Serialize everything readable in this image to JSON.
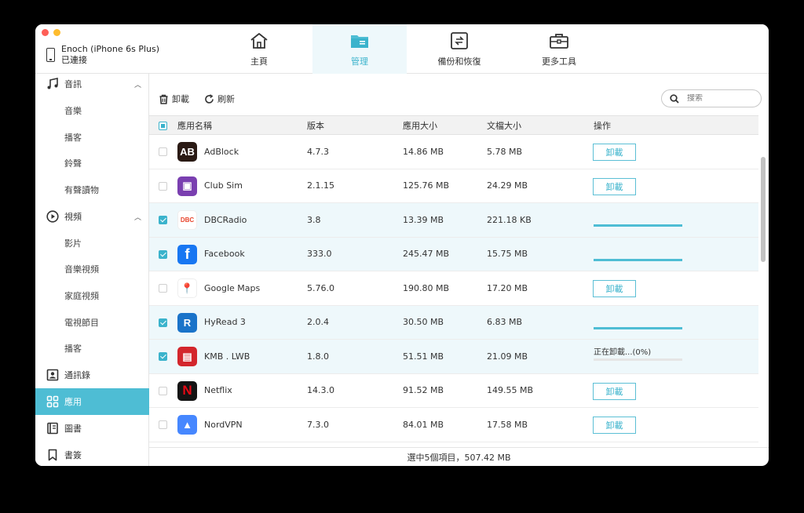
{
  "colors": {
    "accent": "#3bb3cc",
    "accent_light": "#eef8fb",
    "sidebar_active": "#4ebdd4",
    "close": "#fe5f57",
    "minimize": "#febc2e"
  },
  "device": {
    "name": "Enoch (iPhone 6s Plus)",
    "status": "已連接"
  },
  "nav": [
    {
      "label": "主頁",
      "icon": "home-icon"
    },
    {
      "label": "管理",
      "icon": "folder-icon"
    },
    {
      "label": "備份和恢復",
      "icon": "backup-restore-icon"
    },
    {
      "label": "更多工具",
      "icon": "toolbox-icon"
    }
  ],
  "sidebar": {
    "items": [
      {
        "label": "音訊",
        "icon": "music-note-icon"
      },
      {
        "label": "音樂"
      },
      {
        "label": "播客"
      },
      {
        "label": "鈴聲"
      },
      {
        "label": "有聲讀物"
      },
      {
        "label": "視頻",
        "icon": "play-circle-icon"
      },
      {
        "label": "影片"
      },
      {
        "label": "音樂視頻"
      },
      {
        "label": "家庭視頻"
      },
      {
        "label": "電視節目"
      },
      {
        "label": "播客"
      },
      {
        "label": "通訊錄",
        "icon": "contacts-icon"
      },
      {
        "label": "應用",
        "icon": "apps-grid-icon"
      },
      {
        "label": "圖書",
        "icon": "book-icon"
      },
      {
        "label": "書簽",
        "icon": "bookmark-icon"
      }
    ]
  },
  "toolbar": {
    "uninstall_label": "卸載",
    "refresh_label": "刷新",
    "search_placeholder": "搜索"
  },
  "table": {
    "headers": {
      "name": "應用名稱",
      "version": "版本",
      "app_size": "應用大小",
      "doc_size": "文檔大小",
      "action": "操作"
    },
    "uninstall_btn": "卸載",
    "rows": [
      {
        "name": "AdBlock",
        "version": "4.7.3",
        "app_size": "14.86 MB",
        "doc_size": "5.78 MB",
        "checked": false,
        "state": "button",
        "icon": "adblock-app-icon",
        "icon_bg": "#2a1a14",
        "icon_text": "AB"
      },
      {
        "name": "Club Sim",
        "version": "2.1.15",
        "app_size": "125.76 MB",
        "doc_size": "24.29 MB",
        "checked": false,
        "state": "button",
        "icon": "clubsim-app-icon",
        "icon_bg": "#7a3fb0",
        "icon_text": "▣"
      },
      {
        "name": "DBCRadio",
        "version": "3.8",
        "app_size": "13.39 MB",
        "doc_size": "221.18 KB",
        "checked": true,
        "state": "progress",
        "progress": 1.0,
        "icon": "dbcradio-app-icon",
        "icon_bg": "#ffffff",
        "icon_text": "DBC"
      },
      {
        "name": "Facebook",
        "version": "333.0",
        "app_size": "245.47 MB",
        "doc_size": "15.75 MB",
        "checked": true,
        "state": "progress",
        "progress": 1.0,
        "icon": "facebook-app-icon",
        "icon_bg": "#1877f2",
        "icon_text": "f"
      },
      {
        "name": "Google Maps",
        "version": "5.76.0",
        "app_size": "190.80 MB",
        "doc_size": "17.20 MB",
        "checked": false,
        "state": "button",
        "icon": "google-maps-app-icon",
        "icon_bg": "#ffffff",
        "icon_text": "📍"
      },
      {
        "name": "HyRead 3",
        "version": "2.0.4",
        "app_size": "30.50 MB",
        "doc_size": "6.83 MB",
        "checked": true,
        "state": "progress",
        "progress": 1.0,
        "icon": "hyread-app-icon",
        "icon_bg": "#1a73c9",
        "icon_text": "R"
      },
      {
        "name": "KMB . LWB",
        "version": "1.8.0",
        "app_size": "51.51 MB",
        "doc_size": "21.09 MB",
        "checked": true,
        "state": "uninstalling",
        "progress": 0.0,
        "status_text": "正在卸載...(0%)",
        "icon": "kmb-app-icon",
        "icon_bg": "#d3262c",
        "icon_text": "▤"
      },
      {
        "name": "Netflix",
        "version": "14.3.0",
        "app_size": "91.52 MB",
        "doc_size": "149.55 MB",
        "checked": false,
        "state": "button",
        "icon": "netflix-app-icon",
        "icon_bg": "#141414",
        "icon_text": "N"
      },
      {
        "name": "NordVPN",
        "version": "7.3.0",
        "app_size": "84.01 MB",
        "doc_size": "17.58 MB",
        "checked": false,
        "state": "button",
        "icon": "nordvpn-app-icon",
        "icon_bg": "#4687ff",
        "icon_text": "▲"
      }
    ]
  },
  "footer": {
    "summary": "選中5個項目，507.42 MB"
  }
}
